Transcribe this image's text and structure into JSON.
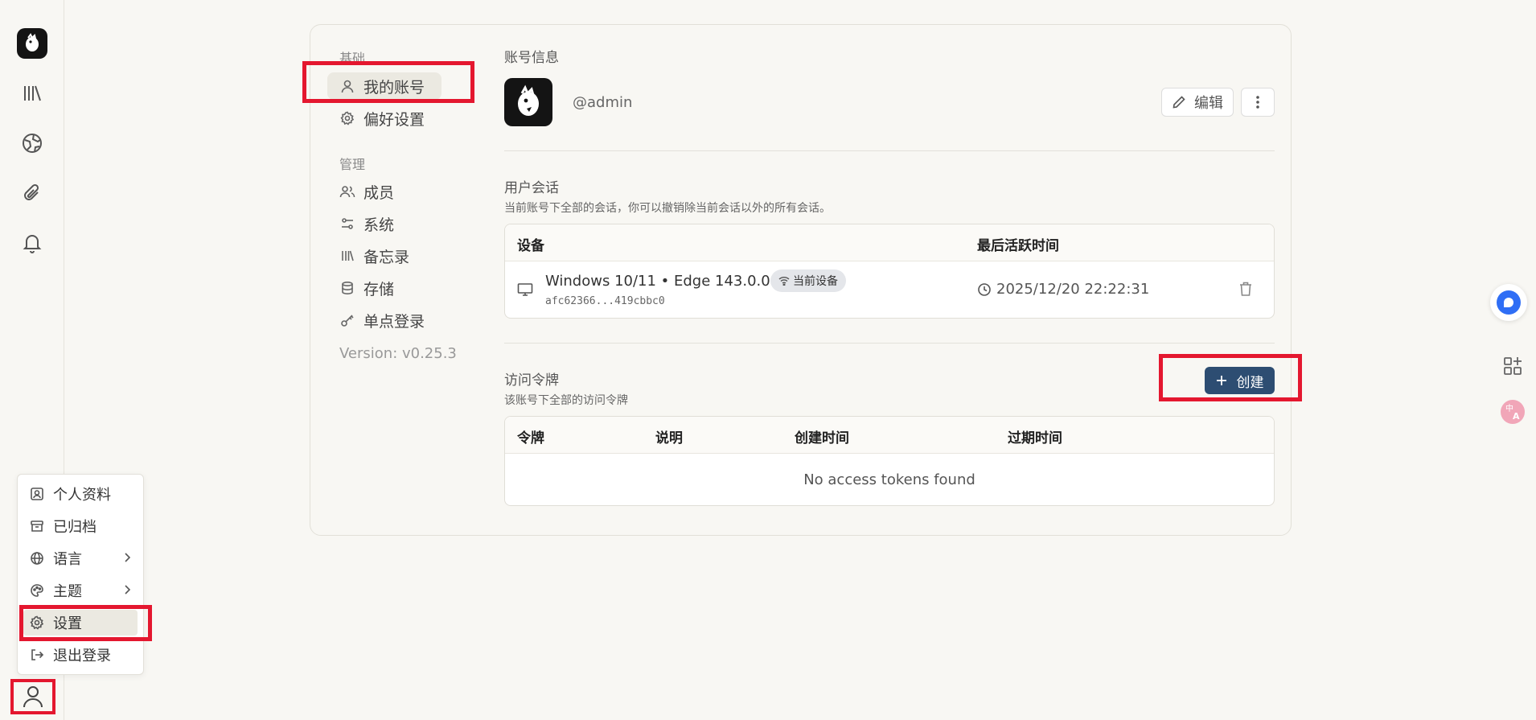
{
  "user_menu": {
    "items": [
      {
        "label": "个人资料"
      },
      {
        "label": "已归档"
      },
      {
        "label": "语言"
      },
      {
        "label": "主题"
      },
      {
        "label": "设置"
      },
      {
        "label": "退出登录"
      }
    ]
  },
  "settings_nav": {
    "group_basic": "基础",
    "my_account": "我的账号",
    "preferences": "偏好设置",
    "group_admin": "管理",
    "members": "成员",
    "system": "系统",
    "memos": "备忘录",
    "storage": "存储",
    "sso": "单点登录",
    "version": "Version: v0.25.3"
  },
  "account": {
    "title": "账号信息",
    "handle": "@admin",
    "edit_label": "编辑"
  },
  "sessions": {
    "title": "用户会话",
    "description": "当前账号下全部的会话，你可以撤销除当前会话以外的所有会话。",
    "col_device": "设备",
    "col_last_active": "最后活跃时间",
    "rows": [
      {
        "device": "Windows 10/11 • Edge 143.0.0.0",
        "id": "afc62366...419cbbc0",
        "badge": "当前设备",
        "last_active": "2025/12/20 22:22:31"
      }
    ]
  },
  "tokens": {
    "title": "访问令牌",
    "description": "该账号下全部的访问令牌",
    "create_label": "创建",
    "col_token": "令牌",
    "col_desc": "说明",
    "col_created": "创建时间",
    "col_expires": "过期时间",
    "empty": "No access tokens found"
  },
  "colors": {
    "highlight": "#e4172f",
    "primary": "#2d4d72",
    "background": "#f8f7f3"
  }
}
